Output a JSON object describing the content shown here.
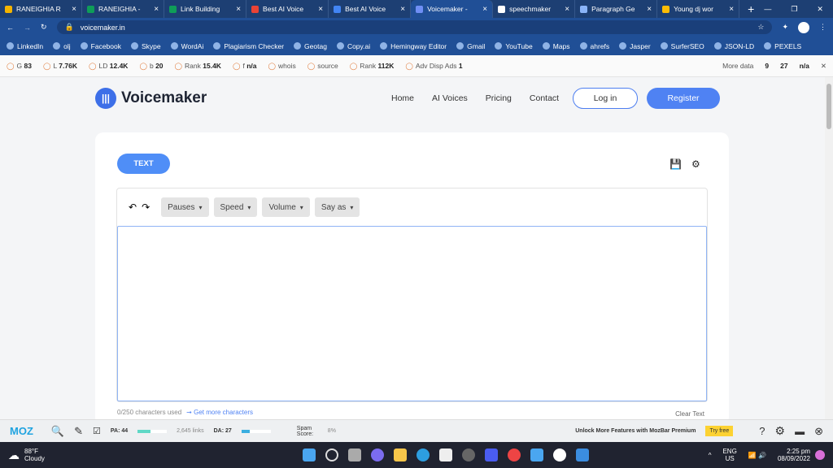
{
  "tabs": [
    {
      "title": "RANEIGHIA R",
      "color": "#f4b400"
    },
    {
      "title": "RANEIGHIA - ",
      "color": "#0f9d58"
    },
    {
      "title": "Link Building",
      "color": "#0f9d58"
    },
    {
      "title": "Best AI Voice",
      "color": "#ea4335"
    },
    {
      "title": "Best AI Voice",
      "color": "#4285f4"
    },
    {
      "title": "Voicemaker - ",
      "color": "#6f8ff5",
      "active": true
    },
    {
      "title": "speechmaker",
      "color": "#fff"
    },
    {
      "title": "Paragraph Ge",
      "color": "#8ab4f8"
    },
    {
      "title": "Young dj wor",
      "color": "#fbbc04"
    }
  ],
  "url": "voicemaker.in",
  "bookmarks": [
    "LinkedIn",
    "olj",
    "Facebook",
    "Skype",
    "WordAi",
    "Plagiarism Checker",
    "Geotag",
    "Copy.ai",
    "Hemingway Editor",
    "Gmail",
    "YouTube",
    "Maps",
    "ahrefs",
    "Jasper",
    "SurferSEO",
    "JSON-LD",
    "PEXELS"
  ],
  "seo": [
    {
      "label": "G",
      "value": "83"
    },
    {
      "label": "L",
      "value": "7.76K"
    },
    {
      "label": "LD",
      "value": "12.4K"
    },
    {
      "label": "b",
      "value": "20"
    },
    {
      "label": "Rank",
      "value": "15.4K"
    },
    {
      "label": "f",
      "value": "n/a"
    },
    {
      "label": "whois",
      "value": ""
    },
    {
      "label": "source",
      "value": ""
    },
    {
      "label": "Rank",
      "value": "112K"
    },
    {
      "label": "Adv Disp Ads",
      "value": "1"
    }
  ],
  "seo_more": "More data",
  "seo_right": [
    "9",
    "27",
    "n/a"
  ],
  "site": {
    "logo": "Voicemaker",
    "nav": [
      "Home",
      "AI Voices",
      "Pricing",
      "Contact"
    ],
    "login": "Log in",
    "register": "Register"
  },
  "editor": {
    "mode": "TEXT",
    "toolbar": [
      "Pauses",
      "Speed",
      "Volume",
      "Say as"
    ],
    "text": "",
    "count": "0/250 characters used",
    "more": "➞ Get more characters",
    "clear": "Clear Text"
  },
  "moz": {
    "logo": "MOZ",
    "pa": "PA: 44",
    "pa_pct": 44,
    "links": "2,645 links",
    "da": "DA: 27",
    "da_pct": 27,
    "spam_label": "Spam Score:",
    "spam": "8%",
    "promo": "Unlock More Features with MozBar Premium",
    "try": "Try free"
  },
  "taskbar": {
    "temp": "88°F",
    "weather": "Cloudy",
    "lang": "ENG",
    "region": "US",
    "time": "2:25 pm",
    "date": "08/09/2022"
  }
}
